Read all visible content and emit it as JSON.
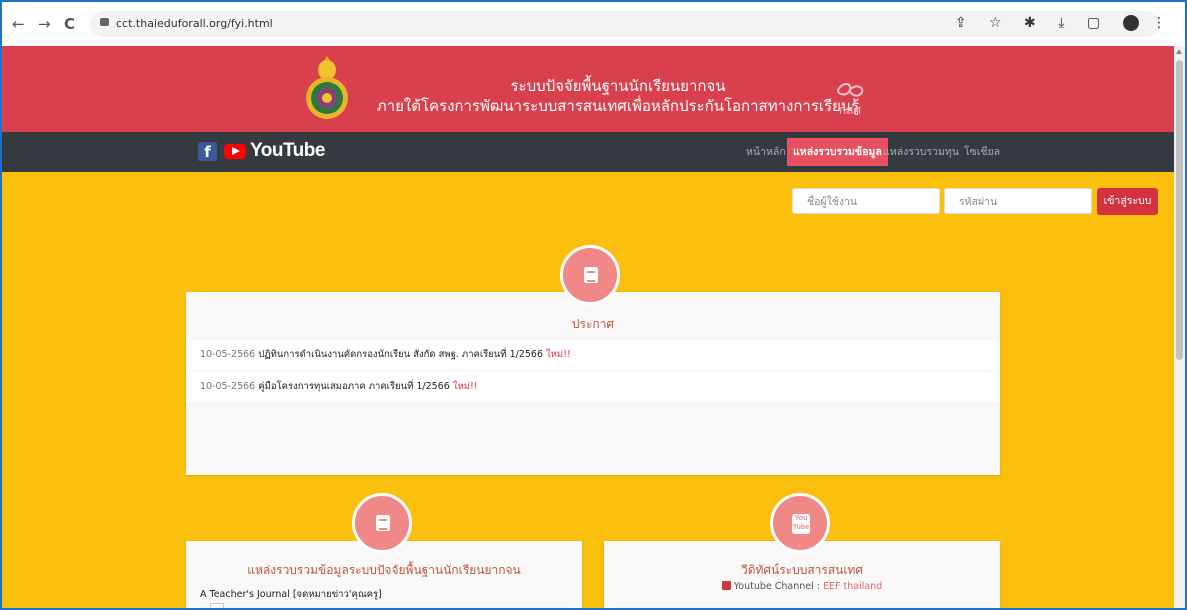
{
  "browser": {
    "back": "←",
    "forward": "→",
    "reload": "C",
    "url": "cct.thaieduforall.org/fyi.html",
    "icons": "⇪ ☆ ✱ ⤓ ▢"
  },
  "header": {
    "line1": "ระบบปัจจัยพื้นฐานนักเรียนยากจน",
    "line2": "ภายใต้โครงการพัฒนาระบบสารสนเทศเพื่อหลักประกันโอกาสทางการเรียนรู้",
    "partner_logo_text": "กสศ"
  },
  "social": {
    "facebook": "f",
    "youtube": "YouTube"
  },
  "menu": [
    {
      "label": "หน้าหลัก",
      "active": false
    },
    {
      "label": "แหล่งรวบรวมข้อมูล",
      "active": true
    },
    {
      "label": "แหล่งรวบรวมทุน",
      "active": false
    },
    {
      "label": "โซเชียล",
      "active": false
    }
  ],
  "login": {
    "username_placeholder": "ชื่อผู้ใช้งาน",
    "password_placeholder": "รหัสผ่าน",
    "button": "เข้าสู่ระบบ"
  },
  "announcements": {
    "title": "ประกาศ",
    "items": [
      {
        "date": "10-05-2566",
        "text": "ปฏิทินการดำเนินงานคัดกรองนักเรียน สังกัด สพฐ. ภาคเรียนที่ 1/2566",
        "badge": "ใหม่!!"
      },
      {
        "date": "10-05-2566",
        "text": "คู่มือโครงการทุนเสมอภาค ภาคเรียนที่ 1/2566",
        "badge": "ใหม่!!"
      }
    ]
  },
  "sources": {
    "title": "แหล่งรวบรวมข้อมูลระบบปัจจัยพื้นฐานนักเรียนยากจน",
    "first_item": "A Teacher's Journal [จดหมายข่าว'คุณครู]"
  },
  "videos": {
    "title": "วีดิทัศน์ระบบสารสนเทศ",
    "channel_label": "Youtube Channel :",
    "channel_name": "EEF thailand",
    "icon_text": "You Tube"
  },
  "colors": {
    "header_red": "#d8404e",
    "page_yellow": "#fbbf0e",
    "nav_dark": "#343a40",
    "accent_pink": "#f18888",
    "login_red": "#d2333f"
  }
}
